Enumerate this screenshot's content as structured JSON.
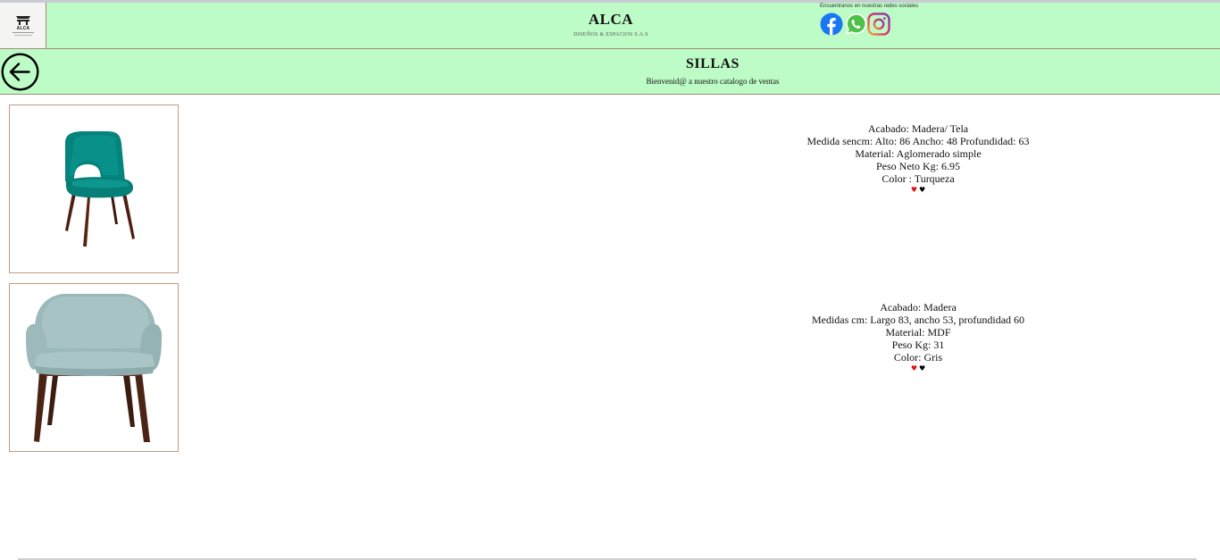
{
  "header": {
    "logo_text": "ALCA",
    "brand_title": "ALCA",
    "brand_subtitle": "DISEÑOS & ESPACIOS S.A.S",
    "social_label": "Encuentranos en nuestras redes sociales",
    "social_icons": [
      "facebook-icon",
      "whatsapp-icon",
      "instagram-icon"
    ]
  },
  "section": {
    "title": "SILLAS",
    "subtitle": "Bienvenid@ a nuestro catalogo de ventas",
    "back_icon": "arrow-left-icon"
  },
  "products": [
    {
      "image_icon": "teal-chair-image",
      "lines": [
        "Acabado: Madera/ Tela",
        "Medida sencm: Alto: 86 Ancho: 48 Profundidad: 63",
        "Material: Aglomerado simple",
        "Peso Neto Kg: 6.95",
        "Color : Turqueza"
      ],
      "hearts": [
        "♥",
        "♥"
      ]
    },
    {
      "image_icon": "gray-armchair-image",
      "lines": [
        "Acabado: Madera",
        "Medidas cm: Largo 83, ancho 53, profundidad 60",
        "Material: MDF",
        "Peso Kg: 31",
        "Color: Gris"
      ],
      "hearts": [
        "♥",
        "♥"
      ]
    }
  ],
  "colors": {
    "header_bg": "#bdfcc6",
    "border": "#a48a73",
    "image_border": "#c49a82",
    "heart_red": "#e01010",
    "heart_black": "#000000"
  }
}
